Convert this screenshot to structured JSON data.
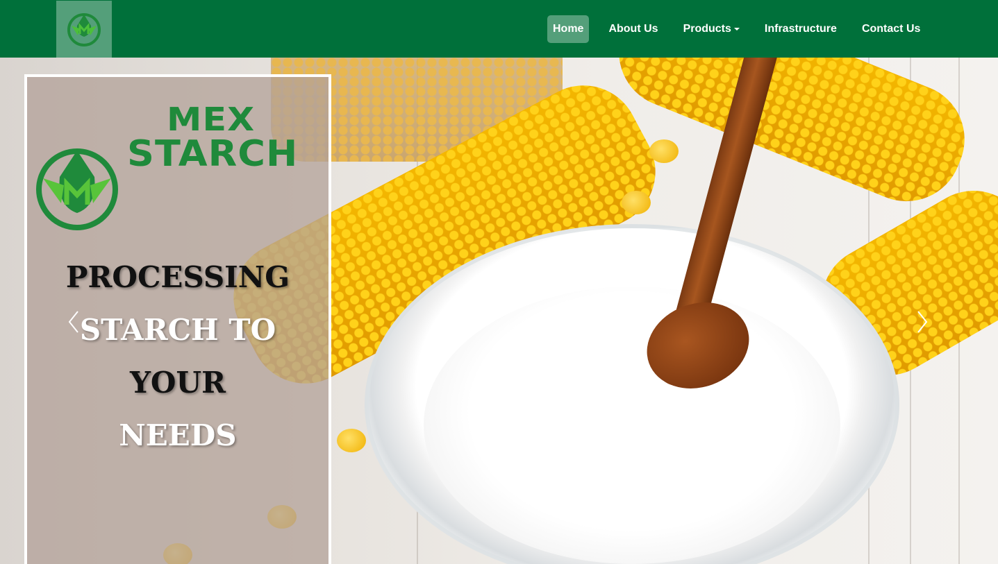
{
  "navbar": {
    "brand_logo": "mex-starch-logo",
    "links": [
      {
        "label": "Home",
        "active": true
      },
      {
        "label": "About Us",
        "active": false
      },
      {
        "label": "Products",
        "active": false,
        "dropdown": true
      },
      {
        "label": "Infrastructure",
        "active": false
      },
      {
        "label": "Contact Us",
        "active": false
      }
    ],
    "background_color": "#00703a"
  },
  "hero": {
    "logo_text_top": "MEX",
    "logo_text_bottom": "STARCH",
    "tagline": [
      "PROCESSING",
      "STARCH TO",
      "YOUR",
      "NEEDS"
    ],
    "prev_icon": "chevron-left-icon",
    "next_icon": "chevron-right-icon"
  },
  "colors": {
    "brand_green": "#1f8a3b",
    "navbar_green": "#00703a",
    "corn_yellow": "#f4b700"
  }
}
